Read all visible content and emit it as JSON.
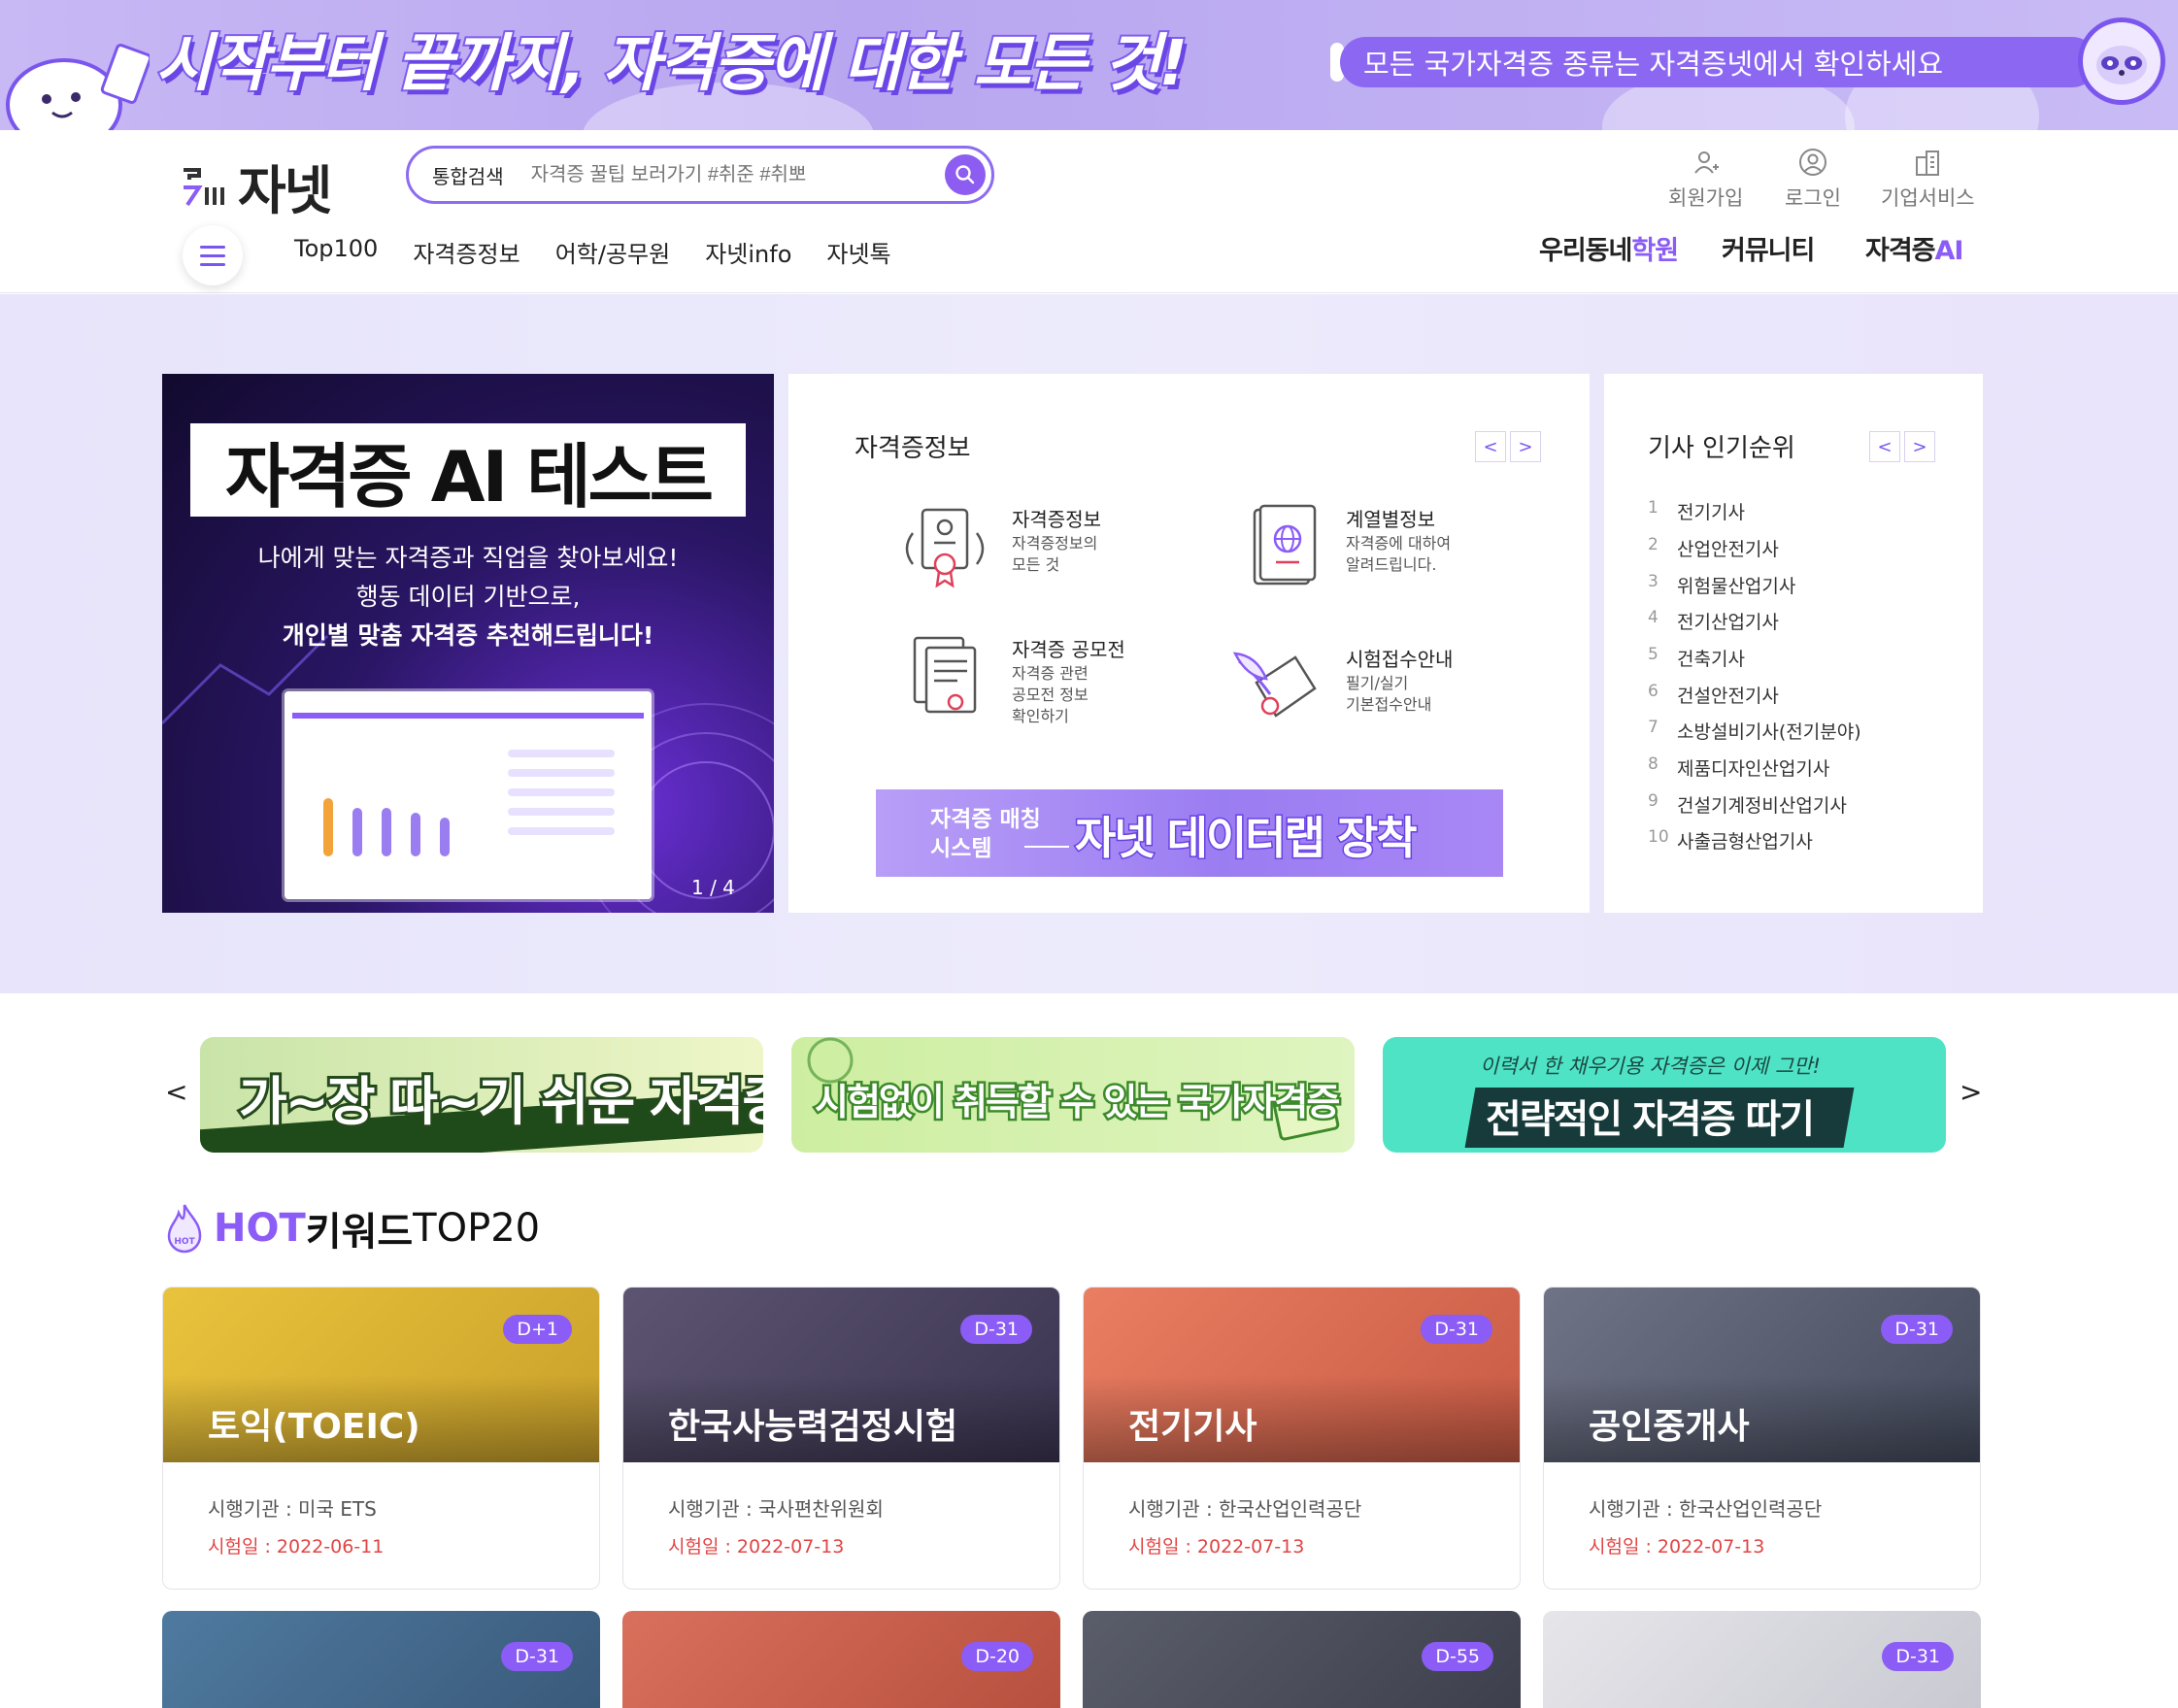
{
  "top_banner": {
    "slogan": "시작부터 끝까지, 자격증에 대한 모든 것!",
    "pill_text": "모든 국가자격증 종류는 자격증넷에서 확인하세요"
  },
  "header": {
    "logo_text": "자넷",
    "search": {
      "type_label": "통합검색",
      "placeholder": "자격증 꿀팁 보러가기 #취준 #취뽀"
    },
    "utils": [
      {
        "label": "회원가입",
        "icon": "user-plus-icon"
      },
      {
        "label": "로그인",
        "icon": "user-circle-icon"
      },
      {
        "label": "기업서비스",
        "icon": "building-icon"
      }
    ],
    "nav": [
      "Top100",
      "자격증정보",
      "어학/공무원",
      "자넷info",
      "자넷톡"
    ],
    "services": {
      "academy": {
        "prefix": "우리동네",
        "accent": "학원"
      },
      "community": "커뮤니티",
      "ai": {
        "prefix": "자격증",
        "accent": "AI"
      }
    }
  },
  "promo": {
    "title": "자격증 AI 테스트",
    "line1": "나에게 맞는 자격증과 직업을 찾아보세요!",
    "line2": "행동 데이터 기반으로,",
    "line3": "개인별 맞춤 자격증 추천해드립니다!",
    "counter": "1 / 4"
  },
  "info_card": {
    "title": "자격증정보",
    "prev": "<",
    "next": ">",
    "items": [
      {
        "title": "자격증정보",
        "desc": "자격증정보의\n모든 것",
        "icon": "certificate-icon"
      },
      {
        "title": "계열별정보",
        "desc": "자격증에 대하여\n알려드립니다.",
        "icon": "passport-globe-icon"
      },
      {
        "title": "자격증 공모전",
        "desc": "자격증 관련\n공모전 정보\n확인하기",
        "icon": "document-award-icon"
      },
      {
        "title": "시험접수안내",
        "desc": "필기/실기\n기본접수안내",
        "icon": "quill-scroll-icon"
      }
    ],
    "datalab": {
      "small": "자격증 매칭\n시스템",
      "big": "자넷 데이터랩 장착"
    }
  },
  "rank_card": {
    "title": "기사 인기순위",
    "prev": "<",
    "next": ">",
    "items": [
      {
        "n": "1",
        "name": "전기기사"
      },
      {
        "n": "2",
        "name": "산업안전기사"
      },
      {
        "n": "3",
        "name": "위험물산업기사"
      },
      {
        "n": "4",
        "name": "전기산업기사"
      },
      {
        "n": "5",
        "name": "건축기사"
      },
      {
        "n": "6",
        "name": "건설안전기사"
      },
      {
        "n": "7",
        "name": "소방설비기사(전기분야)"
      },
      {
        "n": "8",
        "name": "제품디자인산업기사"
      },
      {
        "n": "9",
        "name": "건설기계정비산업기사"
      },
      {
        "n": "10",
        "name": "사출금형산업기사"
      }
    ]
  },
  "mini_banners": {
    "prev": "<",
    "next": ">",
    "b1": "가~장 따~기 쉬운 자격증",
    "b2": "시험없이 취득할 수 있는 국가자격증",
    "b3_sub": "이력서 한 채우기용 자격증은 이제 그만!",
    "b3": "전략적인 자격증 따기"
  },
  "hot": {
    "title_hot": "HOT",
    "title_kw": "키워드",
    "title_top": "TOP20",
    "cards": [
      {
        "dday": "D+1",
        "name": "토익(TOEIC)",
        "org": "시행기관 : 미국 ETS",
        "date": "시험일 : 2022-06-11"
      },
      {
        "dday": "D-31",
        "name": "한국사능력검정시험",
        "org": "시행기관 : 국사편찬위원회",
        "date": "시험일 : 2022-07-13"
      },
      {
        "dday": "D-31",
        "name": "전기기사",
        "org": "시행기관 : 한국산업인력공단",
        "date": "시험일 : 2022-07-13"
      },
      {
        "dday": "D-31",
        "name": "공인중개사",
        "org": "시행기관 : 한국산업인력공단",
        "date": "시험일 : 2022-07-13"
      }
    ],
    "row2": [
      {
        "dday": "D-31"
      },
      {
        "dday": "D-20"
      },
      {
        "dday": "D-55"
      },
      {
        "dday": "D-31"
      }
    ]
  },
  "colors": {
    "accent": "#8b5cf6",
    "date_red": "#e04545"
  }
}
